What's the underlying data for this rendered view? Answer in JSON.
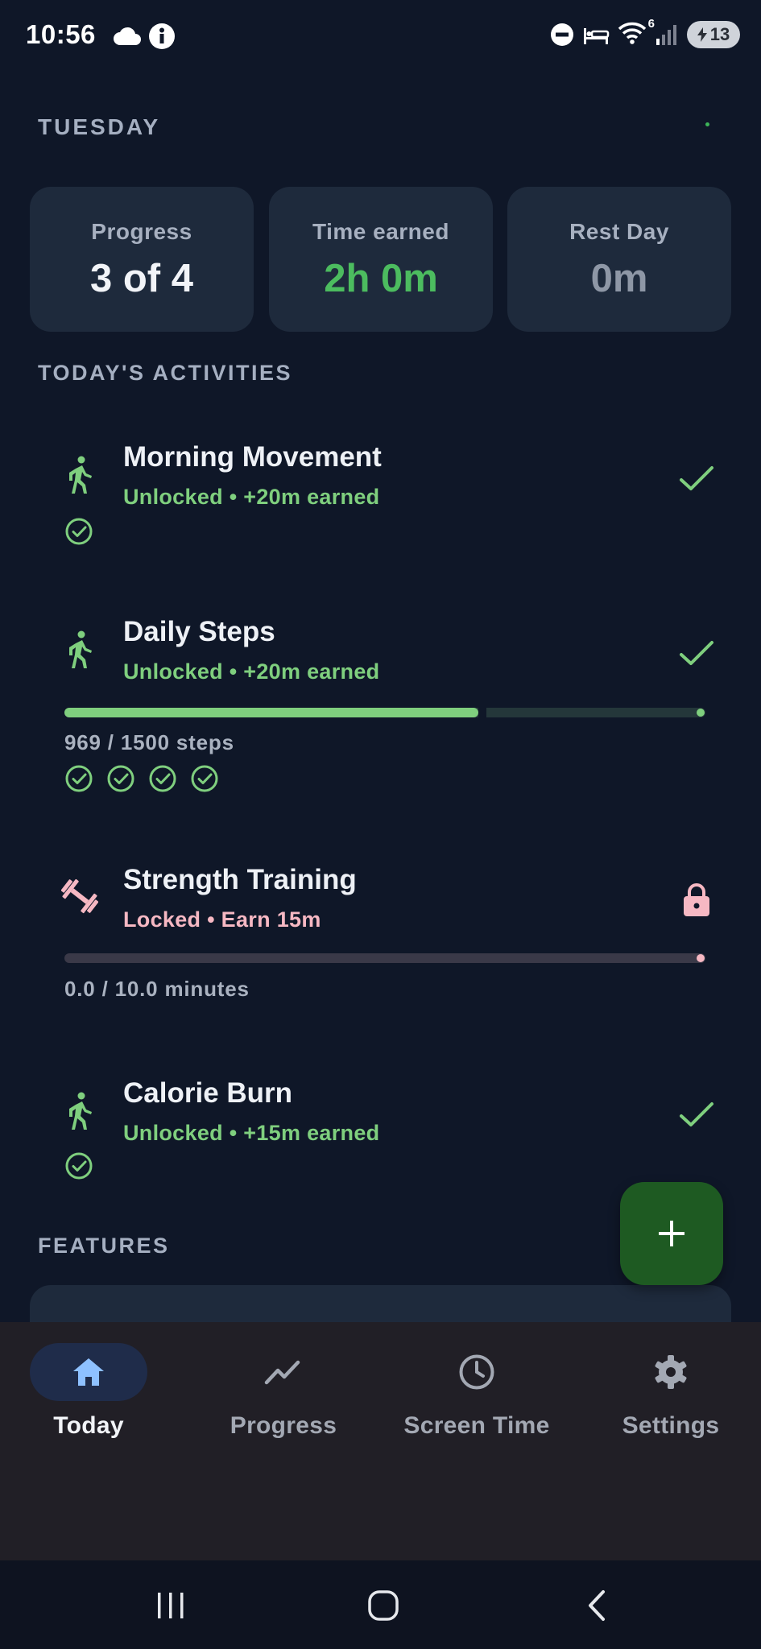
{
  "status_bar": {
    "time": "10:56",
    "left_icons": [
      "cloud-icon",
      "info-icon"
    ],
    "right_icons": [
      "do-not-disturb-icon",
      "sleep-mode-icon",
      "wifi-icon",
      "signal-icon"
    ],
    "wifi_badge": "6",
    "battery": "13"
  },
  "header": {
    "day": "TUESDAY"
  },
  "stats": [
    {
      "label": "Progress",
      "value": "3 of 4",
      "color": "#f2f4f8"
    },
    {
      "label": "Time earned",
      "value": "2h 0m",
      "color": "#4cbc5f"
    },
    {
      "label": "Rest Day",
      "value": "0m",
      "color": "#8e97a6"
    }
  ],
  "sections": {
    "activities": "TODAY'S ACTIVITIES",
    "features": "FEATURES"
  },
  "activities": [
    {
      "title": "Morning Movement",
      "subtitle": "Unlocked • +20m earned",
      "state": "unlocked",
      "icon": "walking-icon",
      "completed_checks": 1
    },
    {
      "title": "Daily Steps",
      "subtitle": "Unlocked • +20m earned",
      "state": "unlocked",
      "icon": "walking-icon",
      "progress_fraction": 0.646,
      "progress_text": "969 / 1500 steps",
      "completed_checks": 4
    },
    {
      "title": "Strength Training",
      "subtitle": "Locked • Earn 15m",
      "state": "locked",
      "icon": "dumbbell-icon",
      "progress_fraction": 0.0,
      "progress_text": "0.0 / 10.0 minutes"
    },
    {
      "title": "Calorie Burn",
      "subtitle": "Unlocked • +15m earned",
      "state": "unlocked",
      "icon": "walking-icon",
      "completed_checks": 1
    }
  ],
  "fab": {
    "icon": "plus-icon"
  },
  "bottom_nav": [
    {
      "label": "Today",
      "icon": "home-icon",
      "active": true
    },
    {
      "label": "Progress",
      "icon": "trending-icon",
      "active": false
    },
    {
      "label": "Screen Time",
      "icon": "clock-icon",
      "active": false
    },
    {
      "label": "Settings",
      "icon": "gear-icon",
      "active": false
    }
  ],
  "system_nav": [
    "recents-icon",
    "home-circle-icon",
    "back-icon"
  ],
  "colors": {
    "background": "#0f1728",
    "card": "#1e2a3c",
    "accent_green": "#4cbc5f",
    "unlocked_text": "#7fcf7e",
    "locked_text": "#f6b8c3",
    "fab": "#1e5a22",
    "nav_active": "#1f2c4a"
  }
}
